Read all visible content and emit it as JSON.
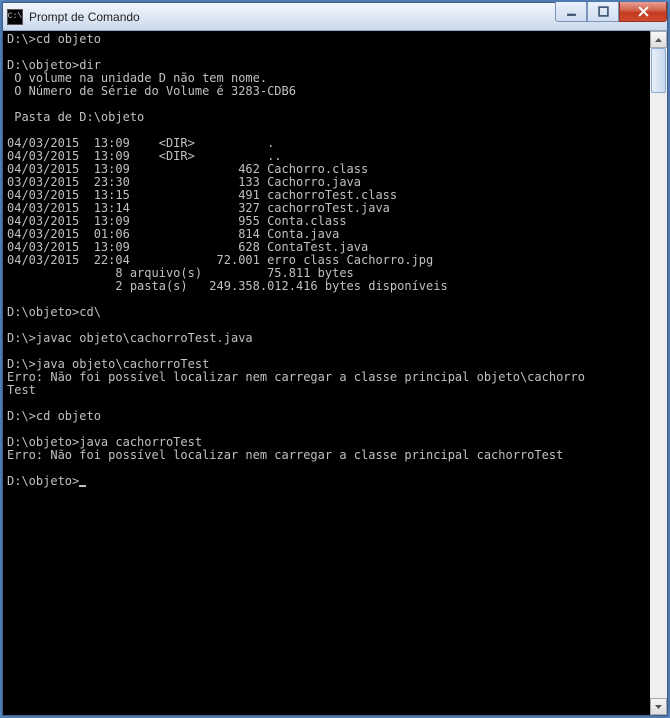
{
  "window": {
    "title": "Prompt de Comando",
    "icon_label": "C:\\"
  },
  "controls": {
    "minimize_aria": "Minimize",
    "maximize_aria": "Maximize",
    "close_aria": "Close"
  },
  "terminal": {
    "lines": [
      "D:\\>cd objeto",
      "",
      "D:\\objeto>dir",
      " O volume na unidade D não tem nome.",
      " O Número de Série do Volume é 3283-CDB6",
      "",
      " Pasta de D:\\objeto",
      "",
      "04/03/2015  13:09    <DIR>          .",
      "04/03/2015  13:09    <DIR>          ..",
      "04/03/2015  13:09               462 Cachorro.class",
      "03/03/2015  23:30               133 Cachorro.java",
      "04/03/2015  13:15               491 cachorroTest.class",
      "04/03/2015  13:14               327 cachorroTest.java",
      "04/03/2015  13:09               955 Conta.class",
      "04/03/2015  01:06               814 Conta.java",
      "04/03/2015  13:09               628 ContaTest.java",
      "04/03/2015  22:04            72.001 erro class Cachorro.jpg",
      "               8 arquivo(s)         75.811 bytes",
      "               2 pasta(s)   249.358.012.416 bytes disponíveis",
      "",
      "D:\\objeto>cd\\",
      "",
      "D:\\>javac objeto\\cachorroTest.java",
      "",
      "D:\\>java objeto\\cachorroTest",
      "Erro: Não foi possível localizar nem carregar a classe principal objeto\\cachorro",
      "Test",
      "",
      "D:\\>cd objeto",
      "",
      "D:\\objeto>java cachorroTest",
      "Erro: Não foi possível localizar nem carregar a classe principal cachorroTest",
      ""
    ],
    "prompt": "D:\\objeto>"
  }
}
